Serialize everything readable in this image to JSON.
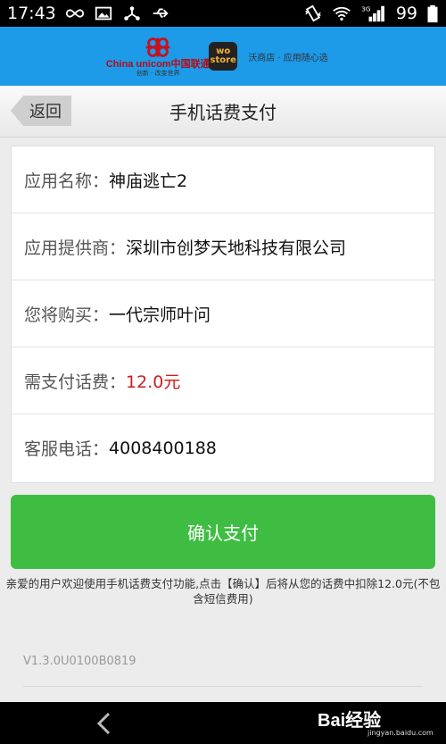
{
  "status_bar": {
    "time": "17:43",
    "battery": "99",
    "network": "3G"
  },
  "brand": {
    "unicom_name": "China unicom中国联通",
    "unicom_slogan": "创新 · 改变世界",
    "wo_store": "wo store",
    "tagline": "沃商店 · 应用随心选"
  },
  "header": {
    "back_label": "返回",
    "title": "手机话费支付"
  },
  "info": {
    "rows": [
      {
        "label": "应用名称：",
        "value": "神庙逃亡2"
      },
      {
        "label": "应用提供商：",
        "value": "深圳市创梦天地科技有限公司"
      },
      {
        "label": "您将购买：",
        "value": "一代宗师叶问"
      },
      {
        "label": "需支付话费：",
        "value": "12.0元"
      },
      {
        "label": "客服电话：",
        "value": "4008400188"
      }
    ]
  },
  "confirm": {
    "label": "确认支付"
  },
  "notice": "亲爱的用户欢迎使用手机话费支付功能,点击【确认】后将从您的话费中扣除12.0元(不包含短信费用)",
  "version": "V1.3.0U0100B0819",
  "watermark": {
    "text": "Bai经验",
    "sub": "jingyan.baidu.com"
  },
  "colors": {
    "banner": "#1d9ae8",
    "confirm": "#3fbd43",
    "fee": "#cc1d1d"
  }
}
